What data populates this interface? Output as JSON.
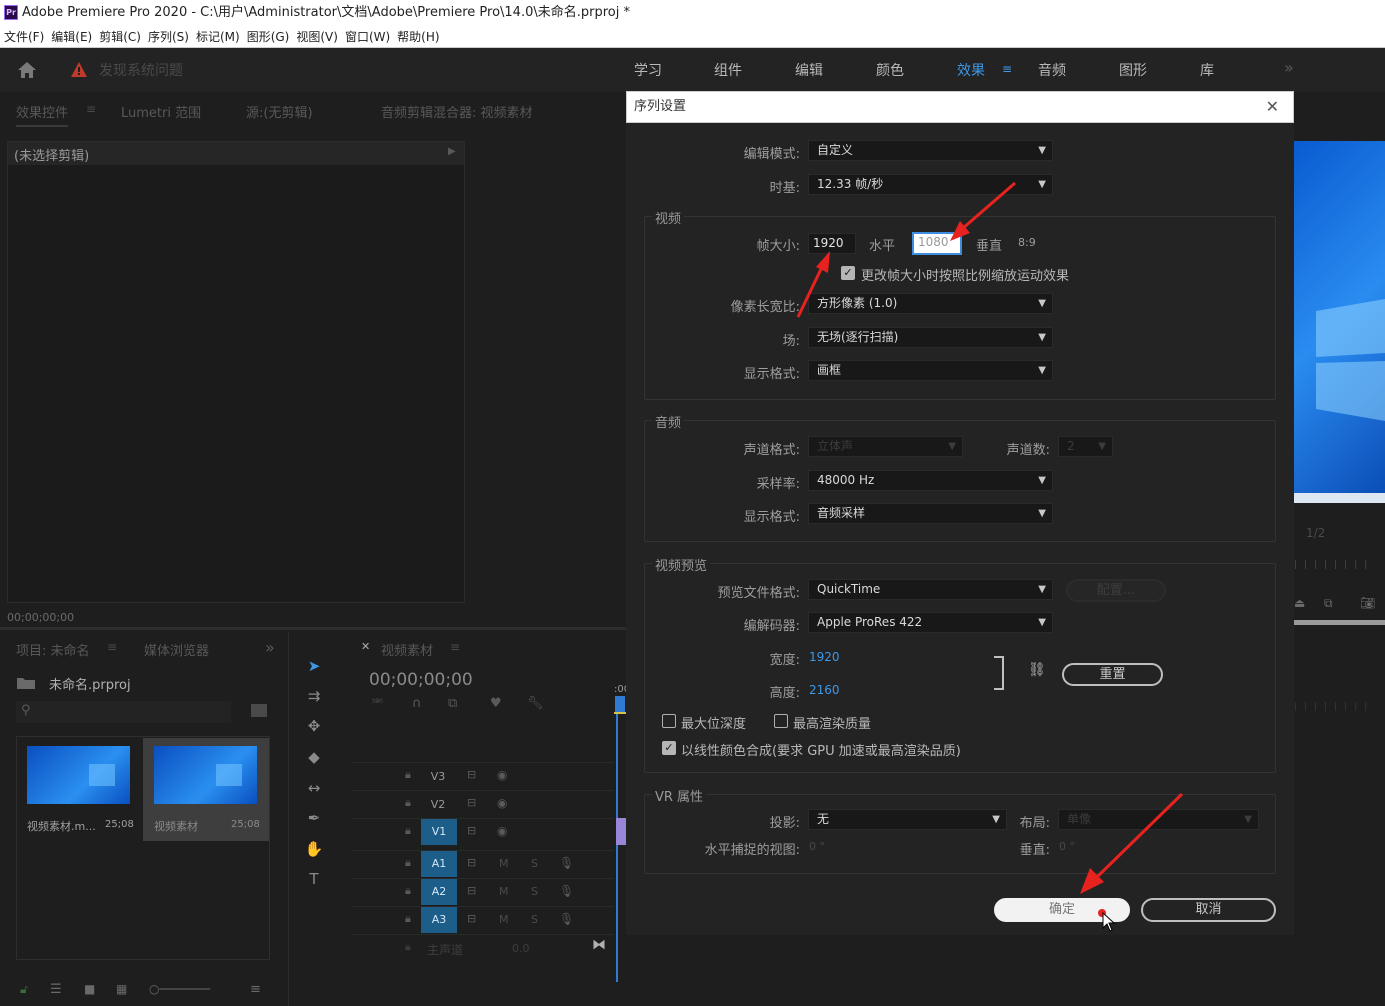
{
  "app": {
    "logo": "Pr",
    "title": "Adobe Premiere Pro 2020 - C:\\用户\\Administrator\\文档\\Adobe\\Premiere Pro\\14.0\\未命名.prproj *"
  },
  "menu": [
    "文件(F)",
    "编辑(E)",
    "剪辑(C)",
    "序列(S)",
    "标记(M)",
    "图形(G)",
    "视图(V)",
    "窗口(W)",
    "帮助(H)"
  ],
  "header": {
    "warning": "发现系统问题",
    "workspaces": [
      "学习",
      "组件",
      "编辑",
      "颜色",
      "效果",
      "音频",
      "图形",
      "库"
    ],
    "active_workspace": "效果"
  },
  "source_panel": {
    "tabs": [
      "效果控件",
      "Lumetri 范围",
      "源:(无剪辑)",
      "音频剪辑混合器: 视频素材"
    ],
    "no_clip": "(未选择剪辑)",
    "timecode": "00;00;00;00"
  },
  "project_panel": {
    "tabs": [
      "项目: 未命名",
      "媒体浏览器"
    ],
    "file": "未命名.prproj",
    "items": [
      {
        "name": "视频素材.m...",
        "duration": "25;08"
      },
      {
        "name": "视频素材",
        "duration": "25;08"
      }
    ]
  },
  "timeline": {
    "tab": "视频素材",
    "timecode": "00;00;00;00",
    "ruler_start": ":00",
    "video_tracks": [
      "V3",
      "V2",
      "V1"
    ],
    "audio_tracks": [
      "A1",
      "A2",
      "A3"
    ],
    "master": "主声道",
    "master_value": "0.0",
    "mute": "M",
    "solo": "S"
  },
  "program_monitor": {
    "fraction": "1/2"
  },
  "dialog": {
    "title": "序列设置",
    "edit_mode_label": "编辑模式:",
    "edit_mode": "自定义",
    "timebase_label": "时基:",
    "timebase": "12.33 帧/秒",
    "video": {
      "title": "视频",
      "frame_size_label": "帧大小:",
      "width": "1920",
      "horizontal": "水平",
      "height": "1080",
      "vertical": "垂直",
      "ratio": "8:9",
      "scale_checkbox": "更改帧大小时按照比例缩放运动效果",
      "pixel_aspect_label": "像素长宽比:",
      "pixel_aspect": "方形像素 (1.0)",
      "field_label": "场:",
      "field": "无场(逐行扫描)",
      "display_label": "显示格式:",
      "display": "画框"
    },
    "audio": {
      "title": "音频",
      "channel_format_label": "声道格式:",
      "channel_format": "立体声",
      "channels_label": "声道数:",
      "channels": "2",
      "sample_rate_label": "采样率:",
      "sample_rate": "48000 Hz",
      "display_label": "显示格式:",
      "display": "音频采样"
    },
    "preview": {
      "title": "视频预览",
      "file_format_label": "预览文件格式:",
      "file_format": "QuickTime",
      "configure": "配置...",
      "codec_label": "编解码器:",
      "codec": "Apple ProRes 422",
      "width_label": "宽度:",
      "width": "1920",
      "height_label": "高度:",
      "height": "2160",
      "reset": "重置",
      "max_bit_depth": "最大位深度",
      "max_render_quality": "最高渲染质量",
      "linear_color": "以线性颜色合成(要求 GPU 加速或最高渲染品质)"
    },
    "vr": {
      "title": "VR 属性",
      "projection_label": "投影:",
      "projection": "无",
      "layout_label": "布局:",
      "layout": "单像",
      "h_view_label": "水平捕捉的视图:",
      "h_view": "0 °",
      "v_label": "垂直:",
      "v_view": "0 °"
    },
    "ok": "确定",
    "cancel": "取消"
  },
  "colors": {
    "accent_blue": "#1d5d89",
    "annotation_red": "#e8231f"
  }
}
